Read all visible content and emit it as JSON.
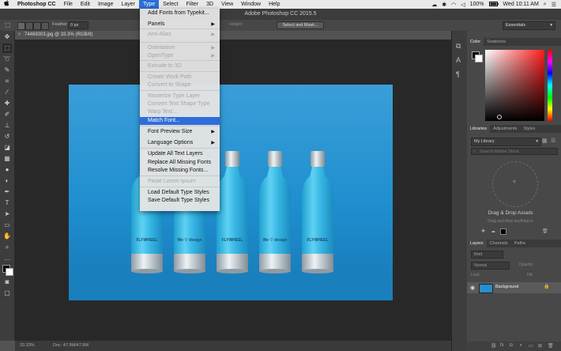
{
  "menubar": {
    "apple": "",
    "app": "Photoshop CC",
    "items": [
      "File",
      "Edit",
      "Image",
      "Layer",
      "Type",
      "Select",
      "Filter",
      "3D",
      "View",
      "Window",
      "Help"
    ],
    "battery": "100%",
    "clock": "Wed 10:11 AM"
  },
  "window": {
    "title": "Adobe Photoshop CC 2015.5"
  },
  "options": {
    "feather_label": "Feather:",
    "feather_value": "0 px",
    "height_label": "Height:",
    "select_mask_button": "Select and Mask...",
    "workspace": "Essentials"
  },
  "document": {
    "tab_title": "74469303.jpg @ 33.3% (RGB/8)",
    "zoom": "33.33%",
    "doc_size": "Doc: 47.9M/47.9M"
  },
  "type_menu": {
    "items": [
      {
        "label": "Add Fonts from Typekit...",
        "enabled": true,
        "submenu": false
      },
      {
        "label": "Panels",
        "enabled": true,
        "submenu": true
      },
      {
        "label": "Anti-Alias",
        "enabled": false,
        "submenu": true
      },
      {
        "label": "Orientation",
        "enabled": false,
        "submenu": true
      },
      {
        "label": "OpenType",
        "enabled": false,
        "submenu": true
      },
      {
        "label": "Extrude to 3D",
        "enabled": false,
        "submenu": false
      },
      {
        "label": "Create Work Path",
        "enabled": false,
        "submenu": false
      },
      {
        "label": "Convert to Shape",
        "enabled": false,
        "submenu": false
      },
      {
        "label": "Rasterize Type Layer",
        "enabled": false,
        "submenu": false
      },
      {
        "label": "Convert Text Shape Type",
        "enabled": false,
        "submenu": false
      },
      {
        "label": "Warp Text...",
        "enabled": false,
        "submenu": false
      },
      {
        "label": "Match Font...",
        "enabled": true,
        "submenu": false,
        "highlighted": true
      },
      {
        "label": "Font Preview Size",
        "enabled": true,
        "submenu": true
      },
      {
        "label": "Language Options",
        "enabled": true,
        "submenu": true
      },
      {
        "label": "Update All Text Layers",
        "enabled": true,
        "submenu": false
      },
      {
        "label": "Replace All Missing Fonts",
        "enabled": true,
        "submenu": false
      },
      {
        "label": "Resolve Missing Fonts...",
        "enabled": true,
        "submenu": false
      },
      {
        "label": "Paste Lorem Ipsum",
        "enabled": false,
        "submenu": false
      },
      {
        "label": "Load Default Type Styles",
        "enabled": true,
        "submenu": false
      },
      {
        "label": "Save Default Type Styles",
        "enabled": true,
        "submenu": false
      }
    ]
  },
  "panels": {
    "color_tabs": [
      "Color",
      "Swatches"
    ],
    "library_tabs": [
      "Libraries",
      "Adjustments",
      "Styles"
    ],
    "library_select": "My Library",
    "library_search": "Search Adobe Stock",
    "drag_title": "Drag & Drop Assets",
    "drag_hint": "Drag and drop anything in",
    "layers_tabs": [
      "Layers",
      "Channels",
      "Paths"
    ],
    "kind_label": "Kind",
    "blend_mode": "Normal",
    "opacity_label": "Opacity:",
    "lock_label": "Lock:",
    "fill_label": "Fill:",
    "layer_name": "Background"
  },
  "bottles": [
    "FLYWHEEL",
    "We ♡ design",
    "FLYWHEEL",
    "We ♡ design",
    "FLYWHEEL",
    "We ♡ design"
  ],
  "colors": {
    "accent": "#2f6ddb",
    "photo_bg": "#1e8fd0",
    "bottle": "#37b6e3"
  }
}
